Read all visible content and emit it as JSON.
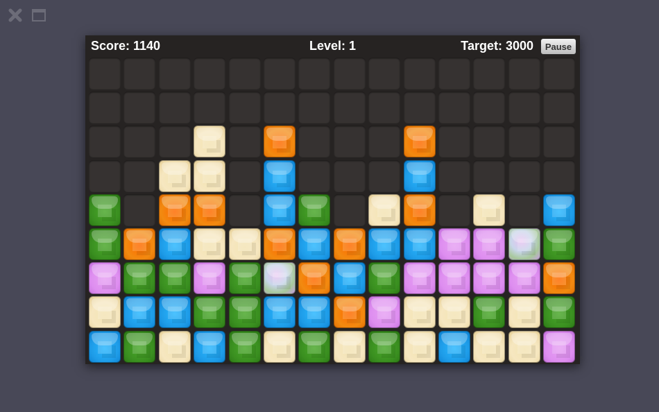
{
  "window": {
    "close_icon": "close-icon",
    "window_icon": "window-icon"
  },
  "hud": {
    "score": "Score: 1140",
    "level": "Level: 1",
    "target": "Target: 3000",
    "pause_label": "Pause"
  },
  "colors": {
    "background": "#484857",
    "board": "#262322",
    "empty_cell": "#363231",
    "orange": "#f28a10",
    "blue": "#1e9ce8",
    "green": "#3a8f20",
    "cream": "#f6e7c0",
    "pink": "#de8ef0"
  },
  "legend": {
    ".": "empty",
    "O": "orange",
    "B": "blue",
    "G": "green",
    "C": "cream",
    "P": "pink",
    "S": "special"
  },
  "board": {
    "columns": 14,
    "rows": [
      "..............",
      "..............",
      "...C.O...O....",
      "..CC.B...B....",
      "G.OO.BG.CO.C.B",
      "GOBCCOBOBBPPSG",
      "PGGPGSOBGPPPPO",
      "CBBGGBBOPCCGCG",
      "BGCBGCGCGCBCCP"
    ]
  }
}
